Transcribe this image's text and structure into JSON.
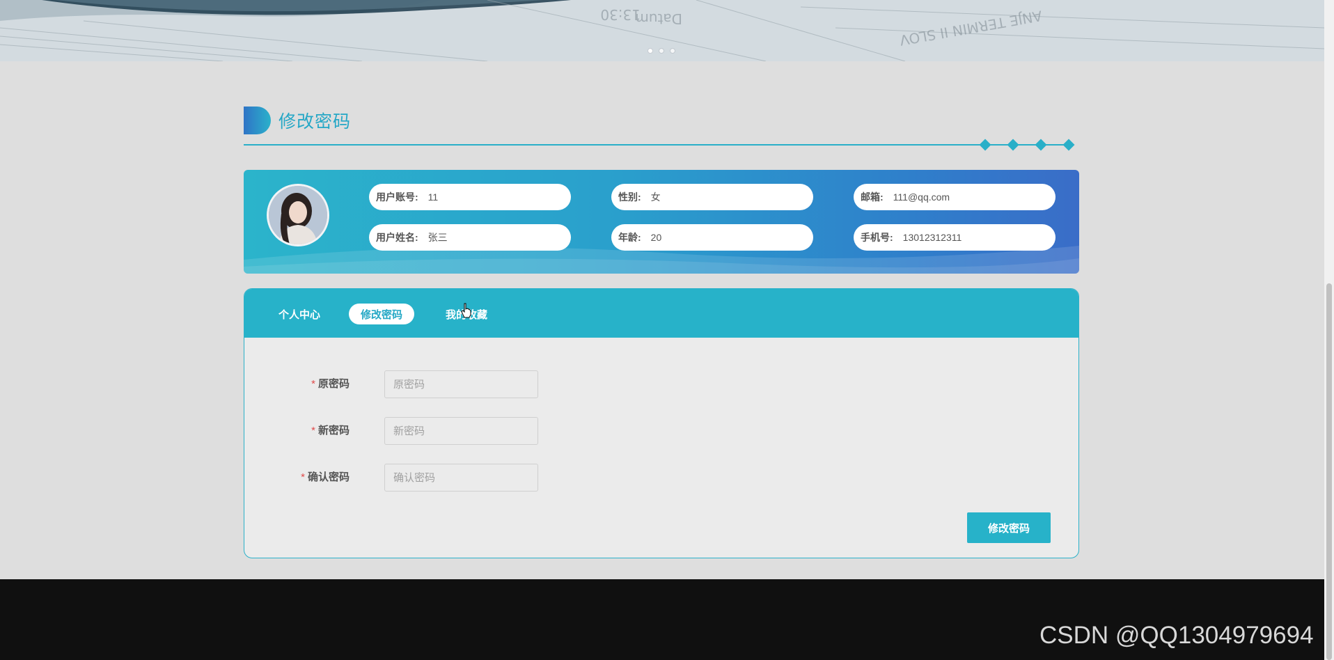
{
  "banner": {
    "indicators": [
      "slide-1",
      "slide-2",
      "slide-3"
    ],
    "active_index": 0
  },
  "section": {
    "title": "修改密码"
  },
  "profile": {
    "account": {
      "label": "用户账号:",
      "value": "11"
    },
    "gender": {
      "label": "性别:",
      "value": "女"
    },
    "email": {
      "label": "邮箱:",
      "value": "111@qq.com"
    },
    "name": {
      "label": "用户姓名:",
      "value": "张三"
    },
    "age": {
      "label": "年龄:",
      "value": "20"
    },
    "phone": {
      "label": "手机号:",
      "value": "13012312311"
    }
  },
  "tabs": [
    {
      "label": "个人中心",
      "active": false
    },
    {
      "label": "修改密码",
      "active": true
    },
    {
      "label": "我的收藏",
      "active": false
    }
  ],
  "form": {
    "old_password": {
      "label": "原密码",
      "placeholder": "原密码",
      "value": ""
    },
    "new_password": {
      "label": "新密码",
      "placeholder": "新密码",
      "value": ""
    },
    "confirm_password": {
      "label": "确认密码",
      "placeholder": "确认密码",
      "value": ""
    },
    "required_mark": "*",
    "submit_label": "修改密码"
  },
  "watermark": "CSDN @QQ1304979694",
  "colors": {
    "accent": "#27b2c9",
    "title": "#25a7c6",
    "footer": "#101010",
    "required": "#e04b4b"
  }
}
